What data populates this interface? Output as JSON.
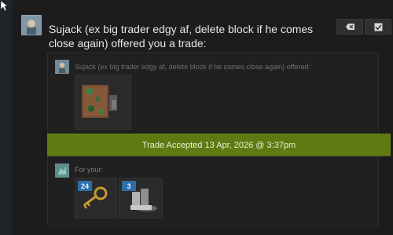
{
  "message": {
    "headline": "Sujack (ex big trader edgy af, delete block if he comes close again) offered you a trade:"
  },
  "actions": {
    "dismiss_icon": "tag-x-icon",
    "confirm_icon": "check-box-icon"
  },
  "offer": {
    "offered_label": "Sujack (ex big trader edgy af, delete block if he comes close again) offered:",
    "for_label": "For your:",
    "offered_item_icon": "crate-icon",
    "requested_items": [
      {
        "icon": "key-icon",
        "quantity": "24"
      },
      {
        "icon": "stacked-item-icon",
        "quantity": "3"
      }
    ]
  },
  "status": {
    "accepted_text": "Trade Accepted 13 Apr, 2026 @ 3:37pm",
    "accent": "#5f7a12"
  }
}
